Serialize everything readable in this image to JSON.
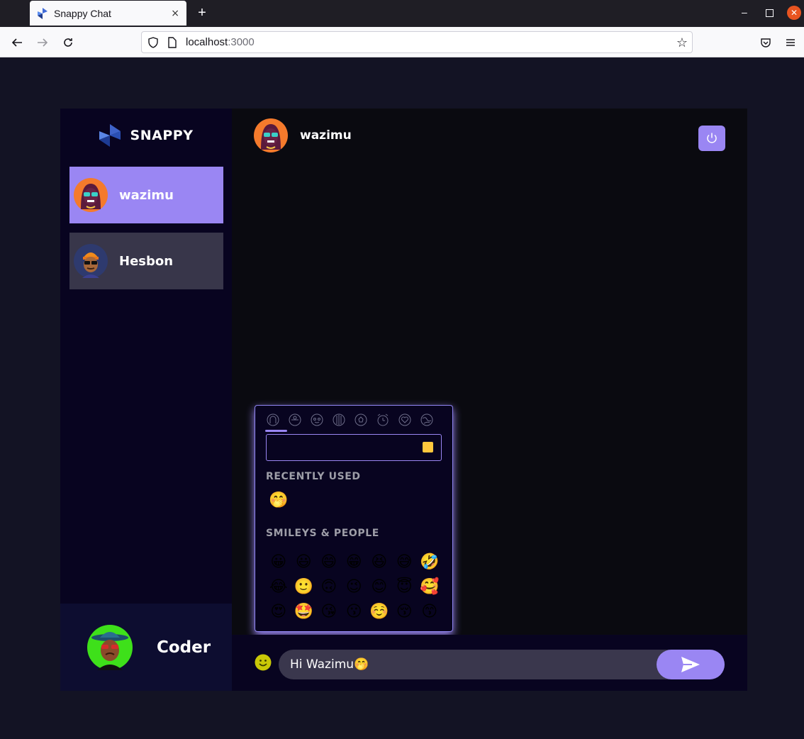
{
  "browser": {
    "tab_title": "Snappy Chat",
    "tab_close_glyph": "×",
    "new_tab_glyph": "+",
    "url_host": "localhost",
    "url_port": ":3000",
    "back_icon": "arrow-left-icon",
    "forward_icon": "arrow-right-icon",
    "reload_icon": "reload-icon",
    "bookmark_icon": "star-icon",
    "pocket_icon": "pocket-icon",
    "menu_icon": "hamburger-menu-icon"
  },
  "brand": {
    "name": "SNAPPY",
    "logo_icon": "snappy-logo-icon"
  },
  "contacts": [
    {
      "name": "wazimu",
      "selected": true,
      "avatar_icon": "avatar-wazimu"
    },
    {
      "name": "Hesbon",
      "selected": false,
      "avatar_icon": "avatar-hesbon"
    }
  ],
  "current_user": {
    "name": "Coder",
    "avatar_icon": "avatar-coder"
  },
  "chat": {
    "username": "wazimu",
    "logout_icon": "power-icon"
  },
  "emoji_picker": {
    "search_placeholder": "",
    "recently_used_title": "RECENTLY USED",
    "smileys_title": "SMILEYS & PEOPLE",
    "recent": [
      "🤭"
    ],
    "smileys": [
      [
        "😀",
        "😃",
        "😄",
        "😁",
        "😆",
        "😅",
        "🤣"
      ],
      [
        "😂",
        "🙂",
        "🙃",
        "😉",
        "😊",
        "😇",
        "🥰"
      ],
      [
        "😍",
        "🤩",
        "😘",
        "😗",
        "☺️",
        "😚",
        "😙"
      ]
    ]
  },
  "input": {
    "message_value": "Hi Wazimu🤭",
    "emoji_toggle_icon": "smiley-icon",
    "send_icon": "send-icon"
  },
  "colors": {
    "accent": "#9a86f3",
    "sidebar_bg": "#080420",
    "chat_bg": "#0a0a10",
    "page_bg": "#131324",
    "current_user_bg": "#0d0d30",
    "contact_bg": "#38364a"
  }
}
